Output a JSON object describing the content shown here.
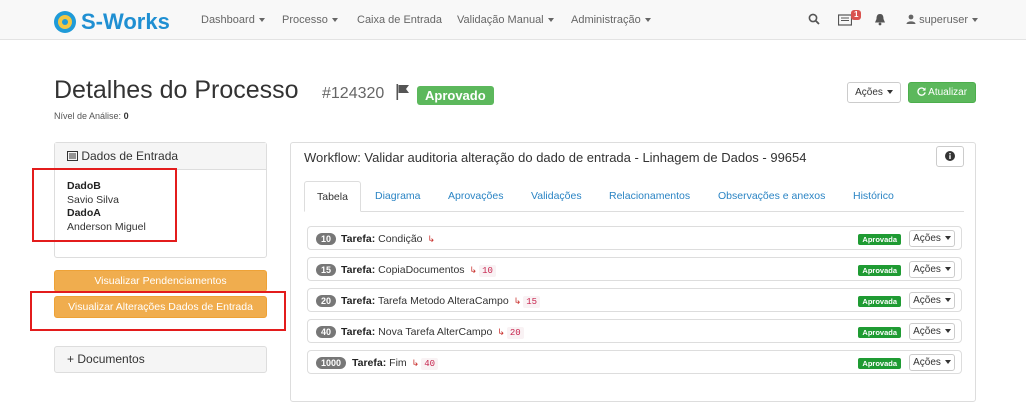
{
  "brand": {
    "name": "S-Works"
  },
  "nav": {
    "items": [
      {
        "label": "Dashboard"
      },
      {
        "label": "Processo"
      },
      {
        "label": "Caixa de Entrada"
      },
      {
        "label": "Validação Manual"
      },
      {
        "label": "Administração"
      }
    ],
    "notification_count": "1",
    "user": "superuser",
    "icons": [
      "search-icon",
      "inbox-icon",
      "bell-icon",
      "user-icon"
    ]
  },
  "header": {
    "title": "Detalhes do Processo",
    "number": "#124320",
    "status": "Aprovado",
    "analysis_label": "Nível de Análise:",
    "analysis_value": "0",
    "acoes_label": "Ações",
    "atualizar_label": "Atualizar"
  },
  "dados_entrada": {
    "title": "Dados de Entrada",
    "items": [
      {
        "key": "DadoB",
        "value": "Savio Silva"
      },
      {
        "key": "DadoA",
        "value": "Anderson Miguel"
      }
    ]
  },
  "buttons": {
    "pendenciamentos": "Visualizar Pendenciamentos",
    "alteracoes": "Visualizar Alterações Dados de Entrada"
  },
  "documentos": {
    "title": "Documentos",
    "prefix": "+"
  },
  "workflow": {
    "title": "Workflow: Validar auditoria alteração do dado de entrada - Linhagem de Dados - 99654",
    "tabs": [
      "Tabela",
      "Diagrama",
      "Aprovações",
      "Validações",
      "Relacionamentos",
      "Observações e anexos",
      "Histórico"
    ],
    "task_prefix": "Tarefa:",
    "tasks": [
      {
        "num": "10",
        "name": "Condição",
        "dep": ""
      },
      {
        "num": "15",
        "name": "CopiaDocumentos",
        "dep": "10"
      },
      {
        "num": "20",
        "name": "Tarefa Metodo AlteraCampo",
        "dep": "15"
      },
      {
        "num": "40",
        "name": "Nova Tarefa AlterCampo",
        "dep": "20"
      },
      {
        "num": "1000",
        "name": "Fim",
        "dep": "40"
      }
    ],
    "task_status": "Aprovada",
    "task_actions": "Ações"
  },
  "colors": {
    "brand": "#1f8fd2",
    "success": "#5cb85c",
    "warning": "#f0ad4e",
    "annotation": "#e31c1c"
  }
}
